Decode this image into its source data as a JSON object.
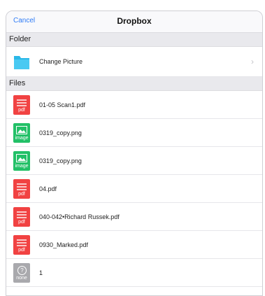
{
  "navbar": {
    "cancel_label": "Cancel",
    "title": "Dropbox"
  },
  "folder_section": {
    "header": "Folder",
    "items": [
      {
        "label": "Change Picture",
        "icon": "folder-icon",
        "color": "#2bb8e8"
      }
    ]
  },
  "files_section": {
    "header": "Files",
    "items": [
      {
        "label": "01-05 Scan1.pdf",
        "type": "pdf",
        "tag": "pdf"
      },
      {
        "label": "0319_copy.png",
        "type": "image",
        "tag": "image"
      },
      {
        "label": "0319_copy.png",
        "type": "image",
        "tag": "image"
      },
      {
        "label": "04.pdf",
        "type": "pdf",
        "tag": "pdf"
      },
      {
        "label": "040-042•Richard Russek.pdf",
        "type": "pdf",
        "tag": "pdf"
      },
      {
        "label": "0930_Marked.pdf",
        "type": "pdf",
        "tag": "pdf"
      },
      {
        "label": "1",
        "type": "none",
        "tag": "none"
      }
    ]
  },
  "colors": {
    "accent": "#2f7cf6",
    "pdf": "#f14242",
    "image": "#22c067",
    "none": "#a9a9ad",
    "folder": "#2bb8e8"
  }
}
